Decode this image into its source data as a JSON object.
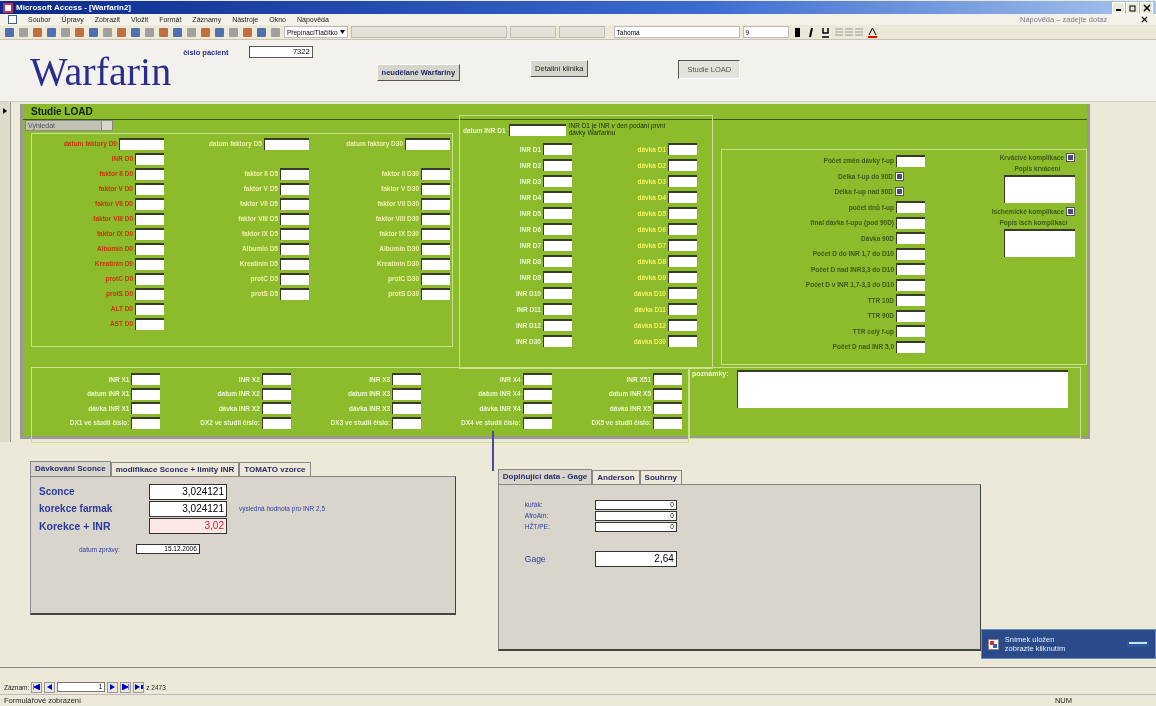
{
  "window": {
    "title": "Microsoft Access - [Warfarin2]"
  },
  "menu": [
    "Soubor",
    "Úpravy",
    "Zobrazit",
    "Vložit",
    "Formát",
    "Záznamy",
    "Nástroje",
    "Okno",
    "Nápověda"
  ],
  "help_box": {
    "placeholder": "Nápověda – zadejte dotaz"
  },
  "toolbar": {
    "control_type": "PřepínacíTlačítko",
    "font": "Tahoma",
    "size": "9"
  },
  "header": {
    "title": "Warfarin",
    "patient_label": "číslo pacient",
    "patient_value": "7322",
    "buttons": [
      {
        "label": "neudělané Warfariny",
        "selected": false
      },
      {
        "label": "Detailní klinika",
        "selected": false
      },
      {
        "label": "Studie LOAD",
        "selected": true
      }
    ]
  },
  "study": {
    "title": "Studie LOAD",
    "search": {
      "placeholder": "Vyhledat"
    },
    "factor_columns": [
      {
        "color": "#c8360e",
        "fields": [
          "datum faktory D0",
          "INR D0",
          "faktor II D0",
          "faktor V D0",
          "faktor VII D0",
          "faktor VIII D0",
          "faktor IX D0",
          "Albumin D0",
          "Kreatinin D0",
          "protC D0",
          "protS D0",
          "ALT D0",
          "AST D0"
        ]
      },
      {
        "color": "#f2f0a8",
        "fields": [
          "datum faktory D5",
          "faktor II D5",
          "faktor V D5",
          "faktor VII D5",
          "faktor VIII D5",
          "faktor IX D5",
          "Albumin D5",
          "Kreatinin D5",
          "protC D5",
          "protS D5"
        ]
      },
      {
        "color": "#f2f0a8",
        "fields": [
          "datum faktory D30",
          "faktor II D30",
          "faktor V D30",
          "faktor VII D30",
          "faktor VIII D30",
          "faktor IX D30",
          "Albumin D30",
          "Kreatinin D30",
          "protC D30",
          "protS D30"
        ]
      }
    ],
    "inr_date_label": "datum INR D1",
    "inr_note": "INR D1 je INR v den podání první dávky Warfarinu",
    "inr_fields": [
      "INR D1",
      "INR D2",
      "INR D3",
      "INR D4",
      "INR D5",
      "INR D6",
      "INR D7",
      "INR D8",
      "INR D9",
      "INR D10",
      "INR D11",
      "INR D12",
      "INR D30"
    ],
    "dose_fields": [
      "dávka D1",
      "dávka D2",
      "dávka D3",
      "dávka D4",
      "dávka D5",
      "dávka D6",
      "dávka D7",
      "dávka D8",
      "dávka D9",
      "dávka D10",
      "dávka D11",
      "dávka D12",
      "dávka D30"
    ],
    "followup_fields": [
      {
        "label": "Počet změn dávky f-up",
        "kind": "field"
      },
      {
        "label": "Délka f-up do 90D",
        "kind": "checkbox",
        "checked": true
      },
      {
        "label": "Délka f-up nad 90D",
        "kind": "checkbox",
        "checked": true
      },
      {
        "label": "počet dnů f-up",
        "kind": "field"
      },
      {
        "label": "final dávka f-upu (pod 90D)",
        "kind": "field"
      },
      {
        "label": "Dávka 90D",
        "kind": "field"
      },
      {
        "label": "Počet D do INR 1,7 do D10",
        "kind": "field"
      },
      {
        "label": "Počet D nad INR3,3 do D10",
        "kind": "field"
      },
      {
        "label": "Počet D v INR 1,7-3,3 do D10",
        "kind": "field"
      },
      {
        "label": "TTR 10D",
        "kind": "field"
      },
      {
        "label": "TTR 90D",
        "kind": "field"
      },
      {
        "label": "TTR celý f-up",
        "kind": "field"
      },
      {
        "label": "Počet D nad INR 5,0",
        "kind": "field"
      }
    ],
    "complications": [
      {
        "label": "Krvácivé komplikace",
        "checked": true,
        "description_label": "Popis krvácení"
      },
      {
        "label": "Ischemické komplikace",
        "checked": true,
        "description_label": "Popis isch komplikací"
      }
    ],
    "extra_columns": [
      [
        "INR X1",
        "datum INR X1",
        "dávka INR X1",
        "DX1 ve studii číslo:"
      ],
      [
        "INR X2",
        "datum INR X2",
        "dávka INR X2",
        "DX2 ve studii číslo:"
      ],
      [
        "INR X3",
        "datum INR X3",
        "dávka INR X3",
        "DX3 ve studii číslo:"
      ],
      [
        "INR X4",
        "datum INR X4",
        "dávka INR X4",
        "DX4 ve studii číslo:"
      ],
      [
        "INR X51",
        "datum INR X5",
        "dávka INR X5",
        "DX5 ve studii číslo:"
      ]
    ],
    "notes_label": "poznámky:"
  },
  "dosing": {
    "tabs": [
      {
        "label": "Dávkování Sconce",
        "selected": true
      },
      {
        "label": "modifikace Sconce + limity INR",
        "selected": false
      },
      {
        "label": "TOMATO vzorce",
        "selected": false
      }
    ],
    "rows": [
      {
        "label": "Sconce",
        "value": "3,024121",
        "kind": "value"
      },
      {
        "label": "korekce farmak",
        "value": "3,024121",
        "kind": "value",
        "note": "výsledná hodnota pro INR 2,5"
      },
      {
        "label": "Korekce + INR",
        "value": "3,02",
        "kind": "result"
      }
    ],
    "report_date_label": "datum zprávy:",
    "report_date": "15.12.2006"
  },
  "extra": {
    "tabs": [
      {
        "label": "Doplňující data - Gage",
        "selected": true
      },
      {
        "label": "Anderson",
        "selected": false
      },
      {
        "label": "Souhrny",
        "selected": false
      }
    ],
    "fields": [
      {
        "label": "kuřák:",
        "value": "0",
        "kind": "small"
      },
      {
        "label": "AfroAm:",
        "value": "0",
        "kind": "small"
      },
      {
        "label": "HŽT/PE:",
        "value": "0",
        "kind": "small"
      },
      {
        "label": "Gage",
        "value": "2,64",
        "kind": "large"
      }
    ]
  },
  "notification": {
    "lines": [
      "Snímek uložen",
      "zobrazte kliknutím"
    ]
  },
  "record_nav": {
    "label": "Záznam:",
    "current": "1",
    "total": "z 2473"
  },
  "status_bar": {
    "text": "Formulářové zobrazení",
    "indicator": "NUM"
  }
}
